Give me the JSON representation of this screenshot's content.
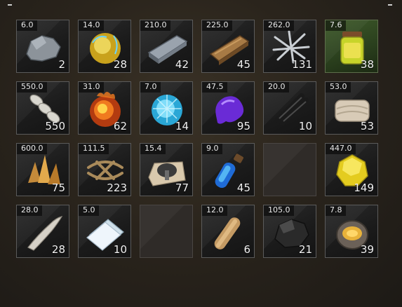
{
  "slots": [
    {
      "weight": "6.0",
      "qty": "2",
      "icon": "stone-icon",
      "empty": false
    },
    {
      "weight": "14.0",
      "qty": "28",
      "icon": "glowing-amber-ore-icon",
      "empty": false
    },
    {
      "weight": "210.0",
      "qty": "42",
      "icon": "iron-ingot-icon",
      "empty": false
    },
    {
      "weight": "225.0",
      "qty": "45",
      "icon": "wood-plank-icon",
      "empty": false
    },
    {
      "weight": "262.0",
      "qty": "131",
      "icon": "nails-icon",
      "empty": false
    },
    {
      "weight": "7.6",
      "qty": "38",
      "icon": "honey-jar-icon",
      "empty": false,
      "highlight": "#3e5a2a"
    },
    {
      "weight": "550.0",
      "qty": "550",
      "icon": "bone-segments-icon",
      "empty": false
    },
    {
      "weight": "31.0",
      "qty": "62",
      "icon": "fire-essence-icon",
      "empty": false
    },
    {
      "weight": "7.0",
      "qty": "14",
      "icon": "ice-crystal-icon",
      "empty": false
    },
    {
      "weight": "47.5",
      "qty": "95",
      "icon": "purple-goo-icon",
      "empty": false
    },
    {
      "weight": "20.0",
      "qty": "10",
      "icon": "black-rods-icon",
      "empty": false
    },
    {
      "weight": "53.0",
      "qty": "53",
      "icon": "cloth-bundle-icon",
      "empty": false
    },
    {
      "weight": "600.0",
      "qty": "75",
      "icon": "amber-crystals-icon",
      "empty": false
    },
    {
      "weight": "111.5",
      "qty": "223",
      "icon": "rope-icon",
      "empty": false
    },
    {
      "weight": "15.4",
      "qty": "77",
      "icon": "mushroom-paper-icon",
      "empty": false
    },
    {
      "weight": "9.0",
      "qty": "45",
      "icon": "blue-vial-icon",
      "empty": false
    },
    {
      "weight": "",
      "qty": "",
      "icon": "",
      "empty": true
    },
    {
      "weight": "447.0",
      "qty": "149",
      "icon": "yellow-gem-icon",
      "empty": false
    },
    {
      "weight": "28.0",
      "qty": "28",
      "icon": "fang-icon",
      "empty": false
    },
    {
      "weight": "5.0",
      "qty": "10",
      "icon": "paper-stack-icon",
      "empty": false
    },
    {
      "weight": "",
      "qty": "",
      "icon": "",
      "empty": true
    },
    {
      "weight": "12.0",
      "qty": "6",
      "icon": "scroll-icon",
      "empty": false
    },
    {
      "weight": "105.0",
      "qty": "21",
      "icon": "coal-icon",
      "empty": false
    },
    {
      "weight": "7.8",
      "qty": "39",
      "icon": "ornate-ring-icon",
      "empty": false
    }
  ]
}
